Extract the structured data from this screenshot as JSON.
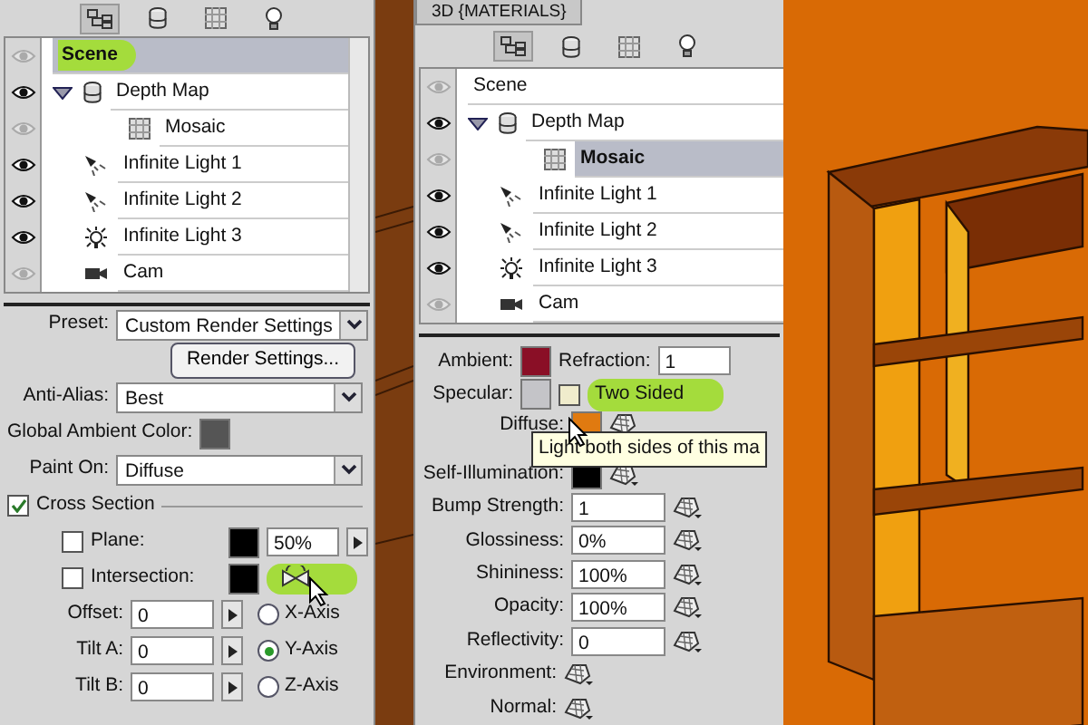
{
  "scene_panel": {
    "toolbar": [
      {
        "kind": "scene",
        "selected": true
      },
      {
        "kind": "mesh",
        "selected": false
      },
      {
        "kind": "material",
        "selected": false
      },
      {
        "kind": "light",
        "selected": false
      }
    ],
    "layers": [
      {
        "label": "Scene",
        "kind": "scene",
        "visible": false,
        "selected": true,
        "highlighted": true
      },
      {
        "label": "Depth Map",
        "kind": "mesh",
        "visible": true,
        "selected": false,
        "expanded": true,
        "children": [
          {
            "label": "Mosaic",
            "kind": "material",
            "visible": false,
            "selected": false
          }
        ]
      },
      {
        "label": "Infinite Light 1",
        "kind": "spot",
        "visible": true,
        "selected": false
      },
      {
        "label": "Infinite Light 2",
        "kind": "spot",
        "visible": true,
        "selected": false
      },
      {
        "label": "Infinite Light 3",
        "kind": "bulb",
        "visible": true,
        "selected": false
      },
      {
        "label": "Cam",
        "kind": "camera",
        "visible": false,
        "selected": false
      }
    ],
    "settings": [
      {
        "kind": "select",
        "label": "Preset:",
        "value": "Custom Render Settings"
      },
      {
        "kind": "button",
        "label": "Render Settings..."
      },
      {
        "kind": "select",
        "label": "Anti-Alias:",
        "value": "Best"
      },
      {
        "kind": "swatch",
        "label": "Global Ambient Color:",
        "color": "#555555"
      },
      {
        "kind": "select",
        "label": "Paint On:",
        "value": "Diffuse"
      },
      {
        "kind": "section",
        "label": "Cross Section",
        "checked": true
      },
      {
        "kind": "plane",
        "label": "Plane:",
        "checked": false,
        "color": "#000000",
        "value": "50%"
      },
      {
        "kind": "intersection",
        "label": "Intersection:",
        "checked": false,
        "color": "#000000",
        "highlighted": true
      },
      {
        "kind": "axis",
        "label": "Offset:",
        "value": "0",
        "axis": "X-Axis",
        "selected": false
      },
      {
        "kind": "axis",
        "label": "Tilt A:",
        "value": "0",
        "axis": "Y-Axis",
        "selected": true
      },
      {
        "kind": "axis",
        "label": "Tilt B:",
        "value": "0",
        "axis": "Z-Axis",
        "selected": false
      }
    ]
  },
  "materials_panel": {
    "title": "3D {MATERIALS}",
    "toolbar": [
      {
        "kind": "scene",
        "selected": true
      },
      {
        "kind": "mesh",
        "selected": false
      },
      {
        "kind": "material",
        "selected": false
      },
      {
        "kind": "light",
        "selected": false
      }
    ],
    "layers": [
      {
        "label": "Scene",
        "kind": "scene",
        "visible": false,
        "selected": false
      },
      {
        "label": "Depth Map",
        "kind": "mesh",
        "visible": true,
        "selected": false,
        "expanded": true,
        "children": [
          {
            "label": "Mosaic",
            "kind": "material",
            "visible": false,
            "selected": true
          }
        ]
      },
      {
        "label": "Infinite Light 1",
        "kind": "spot",
        "visible": true,
        "selected": false
      },
      {
        "label": "Infinite Light 2",
        "kind": "spot",
        "visible": true,
        "selected": false
      },
      {
        "label": "Infinite Light 3",
        "kind": "bulb",
        "visible": true,
        "selected": false
      },
      {
        "label": "Cam",
        "kind": "camera",
        "visible": false,
        "selected": false
      }
    ],
    "properties": [
      {
        "kind": "ambient",
        "label": "Ambient:",
        "color": "#8a0f26",
        "field_label": "Refraction:",
        "value": "1"
      },
      {
        "kind": "specular",
        "label": "Specular:",
        "color": "#c4c4c8",
        "option": "Two Sided",
        "checked": false,
        "highlighted": true
      },
      {
        "kind": "swatch",
        "label": "Diffuse:",
        "color": "#e07a10",
        "tooltip": "Light both sides of this ma"
      },
      {
        "kind": "swatch",
        "label": "Self-Illumination:",
        "color": "#000000"
      },
      {
        "kind": "number",
        "label": "Bump Strength:",
        "value": "1"
      },
      {
        "kind": "number",
        "label": "Glossiness:",
        "value": "0%"
      },
      {
        "kind": "number",
        "label": "Shininess:",
        "value": "100%"
      },
      {
        "kind": "number",
        "label": "Opacity:",
        "value": "100%"
      },
      {
        "kind": "number",
        "label": "Reflectivity:",
        "value": "0"
      },
      {
        "kind": "texture",
        "label": "Environment:"
      },
      {
        "kind": "texture",
        "label": "Normal:"
      }
    ]
  }
}
